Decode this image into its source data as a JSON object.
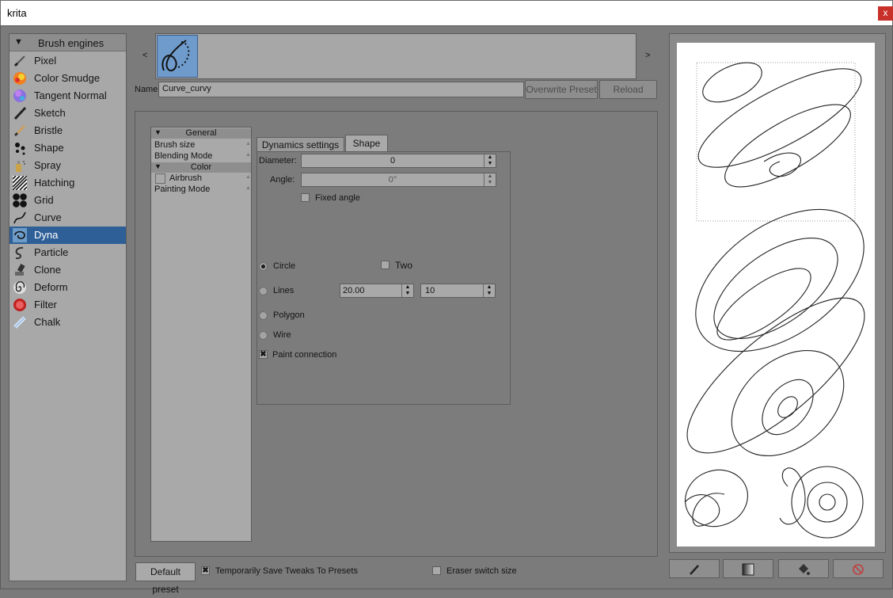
{
  "window": {
    "title": "krita",
    "close_glyph": "x"
  },
  "engines": {
    "header": "Brush engines",
    "items": [
      {
        "label": "Pixel",
        "icon": "pixel-brush-icon",
        "selected": false
      },
      {
        "label": "Color Smudge",
        "icon": "color-smudge-icon",
        "selected": false
      },
      {
        "label": "Tangent Normal",
        "icon": "tangent-normal-icon",
        "selected": false
      },
      {
        "label": "Sketch",
        "icon": "sketch-icon",
        "selected": false
      },
      {
        "label": "Bristle",
        "icon": "bristle-icon",
        "selected": false
      },
      {
        "label": "Shape",
        "icon": "shape-icon",
        "selected": false
      },
      {
        "label": "Spray",
        "icon": "spray-icon",
        "selected": false
      },
      {
        "label": "Hatching",
        "icon": "hatching-icon",
        "selected": false
      },
      {
        "label": "Grid",
        "icon": "grid-icon",
        "selected": false
      },
      {
        "label": "Curve",
        "icon": "curve-icon",
        "selected": false
      },
      {
        "label": "Dyna",
        "icon": "dyna-icon",
        "selected": true
      },
      {
        "label": "Particle",
        "icon": "particle-icon",
        "selected": false
      },
      {
        "label": "Clone",
        "icon": "clone-icon",
        "selected": false
      },
      {
        "label": "Deform",
        "icon": "deform-icon",
        "selected": false
      },
      {
        "label": "Filter",
        "icon": "filter-icon",
        "selected": false
      },
      {
        "label": "Chalk",
        "icon": "chalk-icon",
        "selected": false
      }
    ]
  },
  "preset": {
    "strip_prev": "<",
    "strip_next": ">",
    "name_label": "Name:",
    "name_value": "Curve_curvy",
    "overwrite_label": "Overwrite Preset",
    "reload_label": "Reload"
  },
  "options": {
    "general_header": "General",
    "general_items": [
      "Brush size",
      "Blending Mode"
    ],
    "color_header": "Color",
    "airbrush_label": "Airbrush",
    "painting_mode_label": "Painting Mode"
  },
  "tabs": {
    "dynamics": "Dynamics settings",
    "shape": "Shape",
    "active": "Shape"
  },
  "shape_settings": {
    "diameter_label": "Diameter:",
    "diameter_value": "0",
    "angle_label": "Angle:",
    "angle_value": "0°",
    "fixed_angle_label": "Fixed angle",
    "fixed_angle_checked": false,
    "circle_label": "Circle",
    "two_label": "Two",
    "lines_label": "Lines",
    "lines_value_1": "20.00",
    "lines_value_2": "10",
    "polygon_label": "Polygon",
    "wire_label": "Wire",
    "paint_connection_label": "Paint connection",
    "paint_connection_checked": true,
    "selected_shape": "Circle"
  },
  "bottom": {
    "default_preset_label": "Default preset",
    "save_tweaks_label": "Temporarily Save Tweaks To Presets",
    "save_tweaks_checked": true,
    "eraser_switch_label": "Eraser switch size",
    "eraser_switch_checked": false
  },
  "preview_tools": [
    {
      "icon": "brush-icon"
    },
    {
      "icon": "gradient-icon"
    },
    {
      "icon": "fill-bucket-icon"
    },
    {
      "icon": "clear-icon"
    }
  ],
  "colors": {
    "selection": "#2f5f97",
    "panel": "#a9a9a9",
    "background": "#7b7b7b",
    "close": "#c8302a"
  }
}
